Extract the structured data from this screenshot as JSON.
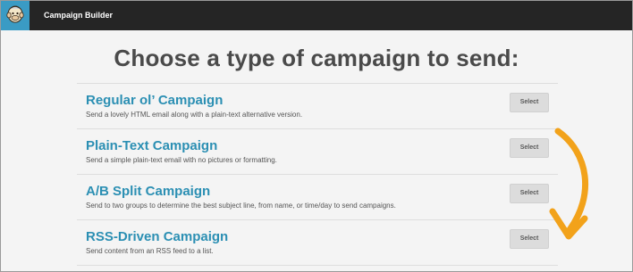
{
  "app": {
    "title": "Campaign Builder"
  },
  "headline": "Choose a type of campaign to send:",
  "campaigns": [
    {
      "title": "Regular ol’ Campaign",
      "description": "Send a lovely HTML email along with a plain-text alternative version.",
      "button": "Select"
    },
    {
      "title": "Plain-Text Campaign",
      "description": "Send a simple plain-text email with no pictures or formatting.",
      "button": "Select"
    },
    {
      "title": "A/B Split Campaign",
      "description": "Send to two groups to determine the best subject line, from name, or time/day to send campaigns.",
      "button": "Select"
    },
    {
      "title": "RSS-Driven Campaign",
      "description": "Send content from an RSS feed to a list.",
      "button": "Select"
    }
  ],
  "colors": {
    "topbar": "#252525",
    "logo_bg": "#3a9bc4",
    "title_link": "#2b8fb3",
    "arrow": "#f2a21a"
  },
  "icons": {
    "logo": "chimp-logo-icon",
    "arrow": "curved-arrow-icon"
  }
}
